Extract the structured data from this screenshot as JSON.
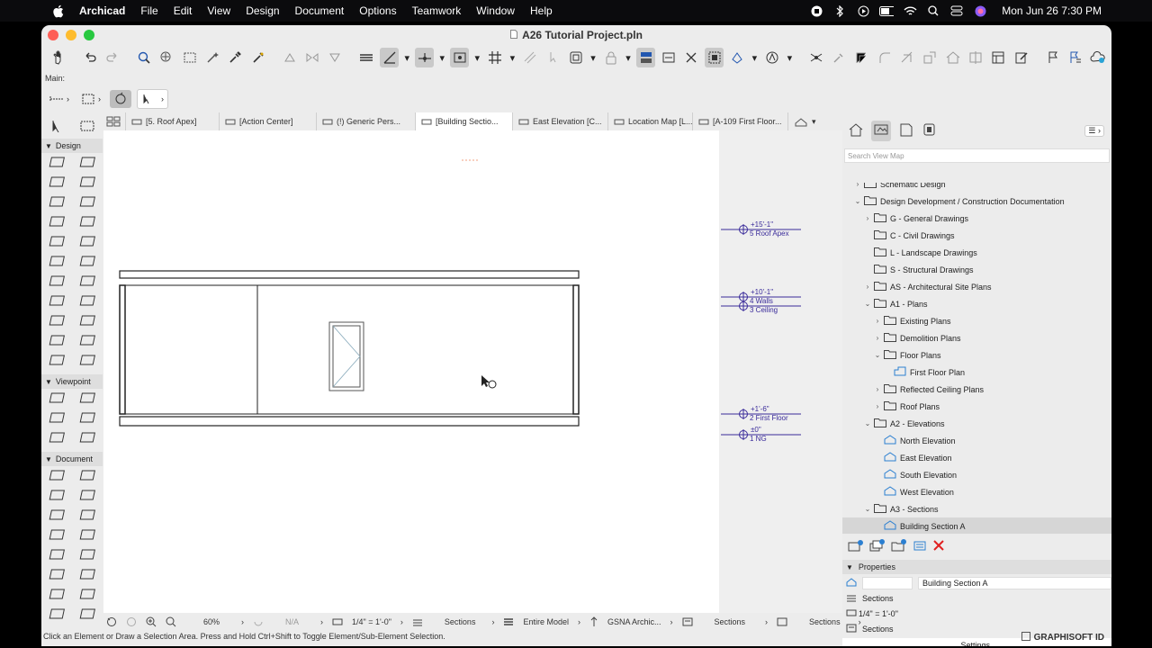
{
  "menubar": {
    "app": "Archicad",
    "items": [
      "File",
      "Edit",
      "View",
      "Design",
      "Document",
      "Options",
      "Teamwork",
      "Window",
      "Help"
    ],
    "clock": "Mon Jun 26  7:30 PM"
  },
  "window": {
    "title": "A26 Tutorial Project.pln"
  },
  "toolbar_label": "Main:",
  "tabs": [
    "[5. Roof Apex]",
    "[Action Center]",
    "(!) Generic Pers...",
    "[Building Sectio...",
    "East Elevation [C...",
    "Location Map [L...",
    "[A-109 First Floor..."
  ],
  "toolbox": {
    "design": "Design",
    "viewpoint": "Viewpoint",
    "document": "Document"
  },
  "levels": [
    {
      "elev": "+15'-1\"",
      "name": "5 Roof Apex"
    },
    {
      "elev": "+10'-1\"",
      "name": "4 Walls"
    },
    {
      "elev": "",
      "name": "3 Ceiling"
    },
    {
      "elev": "+1'-6\"",
      "name": "2 First Floor"
    },
    {
      "elev": "±0\"",
      "name": "1 NG"
    }
  ],
  "navigator": {
    "search_placeholder": "Search View Map",
    "items": [
      {
        "label": "Schematic Design",
        "indent": 0,
        "chev": "›",
        "type": "folder"
      },
      {
        "label": "Design Development / Construction Documentation",
        "indent": 0,
        "chev": "⌄",
        "type": "folder"
      },
      {
        "label": "G - General Drawings",
        "indent": 1,
        "chev": "›",
        "type": "folder"
      },
      {
        "label": "C - Civil Drawings",
        "indent": 1,
        "chev": "",
        "type": "folder"
      },
      {
        "label": "L - Landscape Drawings",
        "indent": 1,
        "chev": "",
        "type": "folder"
      },
      {
        "label": "S - Structural Drawings",
        "indent": 1,
        "chev": "",
        "type": "folder"
      },
      {
        "label": "AS - Architectural Site Plans",
        "indent": 1,
        "chev": "›",
        "type": "folder"
      },
      {
        "label": "A1 - Plans",
        "indent": 1,
        "chev": "⌄",
        "type": "folder"
      },
      {
        "label": "Existing Plans",
        "indent": 2,
        "chev": "›",
        "type": "folder"
      },
      {
        "label": "Demolition Plans",
        "indent": 2,
        "chev": "›",
        "type": "folder"
      },
      {
        "label": "Floor Plans",
        "indent": 2,
        "chev": "⌄",
        "type": "folder"
      },
      {
        "label": "First Floor Plan",
        "indent": 3,
        "chev": "",
        "type": "plan"
      },
      {
        "label": "Reflected Ceiling Plans",
        "indent": 2,
        "chev": "›",
        "type": "folder"
      },
      {
        "label": "Roof Plans",
        "indent": 2,
        "chev": "›",
        "type": "folder"
      },
      {
        "label": "A2 - Elevations",
        "indent": 1,
        "chev": "⌄",
        "type": "folder"
      },
      {
        "label": "North Elevation",
        "indent": 2,
        "chev": "",
        "type": "view"
      },
      {
        "label": "East Elevation",
        "indent": 2,
        "chev": "",
        "type": "view"
      },
      {
        "label": "South Elevation",
        "indent": 2,
        "chev": "",
        "type": "view"
      },
      {
        "label": "West Elevation",
        "indent": 2,
        "chev": "",
        "type": "view"
      },
      {
        "label": "A3 - Sections",
        "indent": 1,
        "chev": "⌄",
        "type": "folder"
      },
      {
        "label": "Building Section A",
        "indent": 2,
        "chev": "",
        "type": "view",
        "selected": true
      }
    ]
  },
  "properties": {
    "header": "Properties",
    "name": "Building Section A",
    "type1": "Sections",
    "scale": "1/4\"   =   1'-0\"",
    "type2": "Sections",
    "settings": "Settings..."
  },
  "statusbar": {
    "zoom": "60%",
    "angle": "N/A",
    "scale": "1/4\"   =   1'-0\"",
    "layers": "Sections",
    "model": "Entire Model",
    "pen": "GSNA Archic...",
    "view1": "Sections",
    "view2": "Sections"
  },
  "hint": "Click an Element or Draw a Selection Area. Press and Hold Ctrl+Shift to Toggle Element/Sub-Element Selection.",
  "brand": "GRAPHISOFT ID"
}
